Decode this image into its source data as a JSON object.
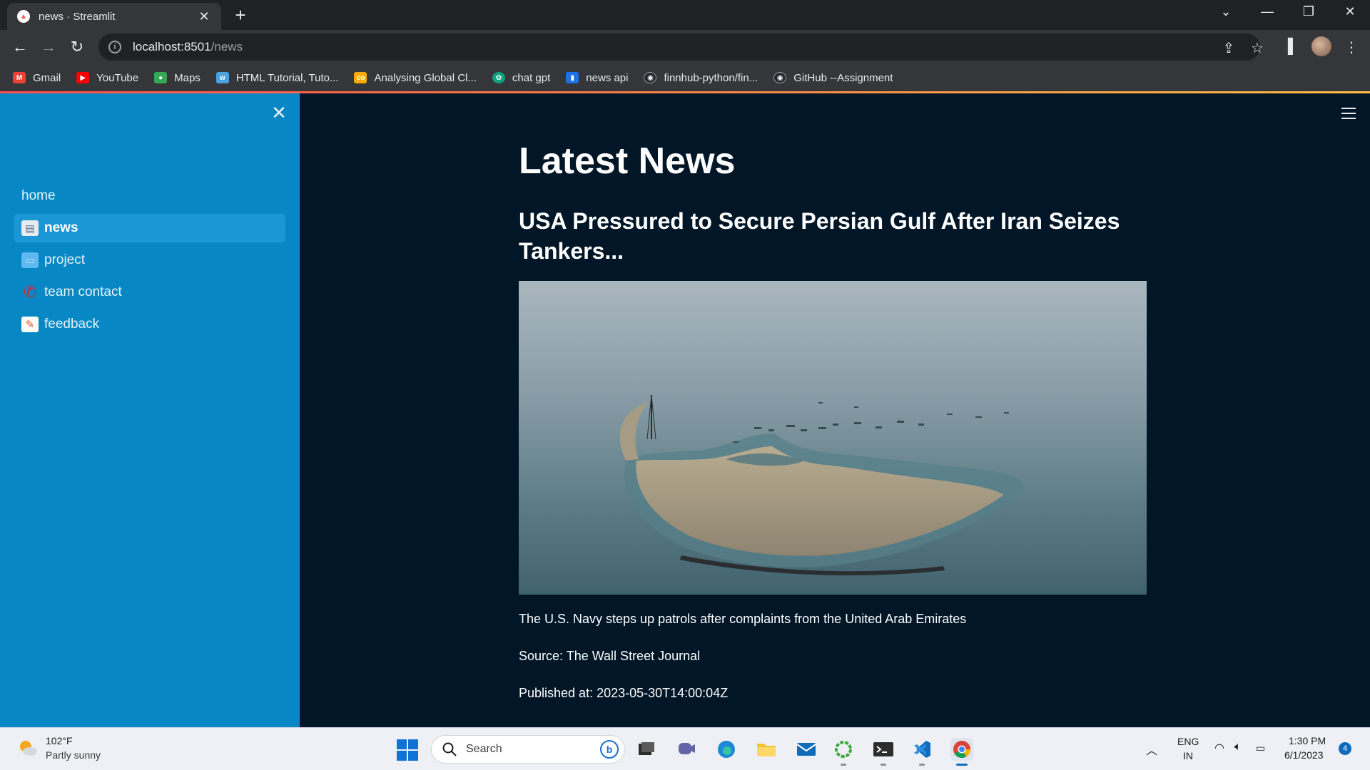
{
  "browser": {
    "tab": {
      "title": "news · Streamlit"
    },
    "url": {
      "host": "localhost:8501",
      "path": "/news"
    },
    "bookmarks": [
      {
        "label": "Gmail",
        "icon": "gmail-icon",
        "color": "#ea4335"
      },
      {
        "label": "YouTube",
        "icon": "youtube-icon",
        "color": "#ff0000"
      },
      {
        "label": "Maps",
        "icon": "maps-icon",
        "color": "#34a853"
      },
      {
        "label": "HTML Tutorial, Tuto...",
        "icon": "w3schools-icon",
        "color": "#4aa3df"
      },
      {
        "label": "Analysing Global Cl...",
        "icon": "colab-icon",
        "color": "#f9ab00"
      },
      {
        "label": "chat gpt",
        "icon": "chatgpt-icon",
        "color": "#10a37f"
      },
      {
        "label": "news api",
        "icon": "newsapi-icon",
        "color": "#1a73e8"
      },
      {
        "label": "finnhub-python/fin...",
        "icon": "github-icon",
        "color": "#24292f"
      },
      {
        "label": "GitHub --Assignment",
        "icon": "github-icon",
        "color": "#24292f"
      }
    ]
  },
  "sidebar": {
    "items": [
      {
        "label": "home",
        "icon": ""
      },
      {
        "label": "news",
        "icon": "newspaper-icon",
        "active": true
      },
      {
        "label": "project",
        "icon": "computer-icon"
      },
      {
        "label": "team contact",
        "icon": "telephone-icon"
      },
      {
        "label": "feedback",
        "icon": "memo-icon"
      }
    ]
  },
  "main": {
    "page_title": "Latest News",
    "article": {
      "title": "USA Pressured to Secure Persian Gulf After Iran Seizes Tankers...",
      "description": "The U.S. Navy steps up patrols after complaints from the United Arab Emirates",
      "source": "Source: The Wall Street Journal",
      "published": "Published at: 2023-05-30T14:00:04Z"
    }
  },
  "taskbar": {
    "weather": {
      "temp": "102°F",
      "desc": "Partly sunny"
    },
    "search_label": "Search",
    "lang": {
      "line1": "ENG",
      "line2": "IN"
    },
    "clock": {
      "time": "1:30 PM",
      "date": "6/1/2023"
    },
    "notifications": "4"
  },
  "colors": {
    "sidebar_bg": "#0788c5",
    "main_bg": "#011627",
    "accent": "#ff4b4b"
  }
}
